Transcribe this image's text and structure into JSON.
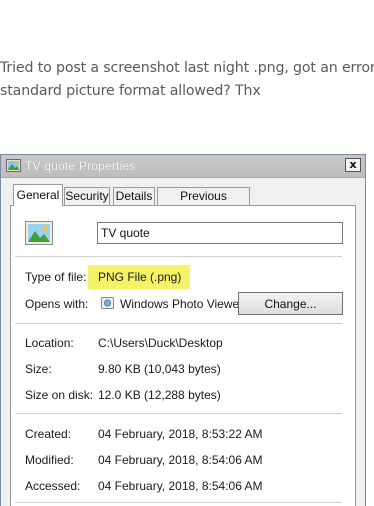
{
  "post": {
    "lines": [
      "Tried to post a screenshot last night .png, got an error",
      "standard picture format allowed? Thx"
    ]
  },
  "dialog": {
    "title": "TV quote Properties",
    "close_glyph": "x",
    "tabs": [
      {
        "label": "General",
        "active": true
      },
      {
        "label": "Security",
        "active": false
      },
      {
        "label": "Details",
        "active": false
      },
      {
        "label": "Previous Versions",
        "active": false
      }
    ],
    "file_name": "TV quote",
    "type_of_file": {
      "label": "Type of file:",
      "value": "PNG File (.png)"
    },
    "opens_with": {
      "label": "Opens with:",
      "value": "Windows Photo Viewer",
      "change_label": "Change..."
    },
    "location": {
      "label": "Location:",
      "value": "C:\\Users\\Duck\\Desktop"
    },
    "size": {
      "label": "Size:",
      "value": "9.80 KB (10,043 bytes)"
    },
    "size_on_disk": {
      "label": "Size on disk:",
      "value": "12.0 KB (12,288 bytes)"
    },
    "created": {
      "label": "Created:",
      "value": "04 February, 2018, 8:53:22 AM"
    },
    "modified": {
      "label": "Modified:",
      "value": "04 February, 2018, 8:54:06 AM"
    },
    "accessed": {
      "label": "Accessed:",
      "value": "04 February, 2018, 8:54:06 AM"
    },
    "icons": {
      "title": "image-file-icon",
      "file": "image-file-icon",
      "viewer": "photo-viewer-icon"
    },
    "colors": {
      "highlight": "#f2f04a",
      "titlebar": "#c4c4c4"
    }
  }
}
